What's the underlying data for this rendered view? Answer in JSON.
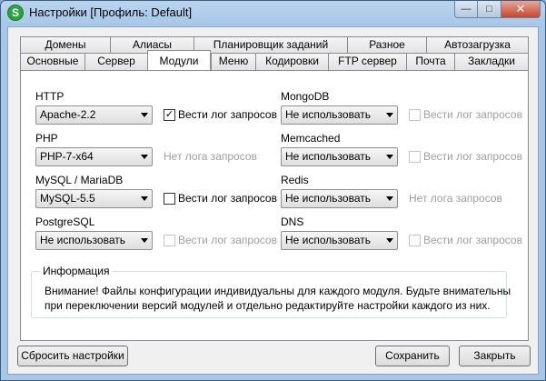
{
  "window": {
    "title": "Настройки [Профиль: Default]",
    "app_icon_letter": "S"
  },
  "tabs": {
    "row1": [
      "Домены",
      "Алиасы",
      "Планировщик заданий",
      "Разное",
      "Автозагрузка"
    ],
    "row2": [
      "Основные",
      "Сервер",
      "Модули",
      "Меню",
      "Кодировки",
      "FTP сервер",
      "Почта",
      "Закладки"
    ],
    "active": "Модули"
  },
  "modules": {
    "http": {
      "label": "HTTP",
      "value": "Apache-2.2",
      "log_label": "Вести лог запросов",
      "log_checked": true
    },
    "php": {
      "label": "PHP",
      "value": "PHP-7-x64",
      "no_log_text": "Нет лога запросов"
    },
    "mysql": {
      "label": "MySQL / MariaDB",
      "value": "MySQL-5.5",
      "log_label": "Вести лог запросов",
      "log_checked": false
    },
    "postgresql": {
      "label": "PostgreSQL",
      "value": "Не использовать",
      "log_label": "Вести лог запросов",
      "log_checked": false
    },
    "mongodb": {
      "label": "MongoDB",
      "value": "Не использовать",
      "log_label": "Вести лог запросов",
      "log_checked": false
    },
    "memcached": {
      "label": "Memcached",
      "value": "Не использовать",
      "log_label": "Вести лог запросов",
      "log_checked": false
    },
    "redis": {
      "label": "Redis",
      "value": "Не использовать",
      "no_log_text": "Нет лога запросов"
    },
    "dns": {
      "label": "DNS",
      "value": "Не использовать",
      "log_label": "Вести лог запросов",
      "log_checked": false
    }
  },
  "info": {
    "title": "Информация",
    "line1": "Внимание! Файлы конфигурации индивидуальны для каждого модуля. Будьте внимательны",
    "line2": "при переключении версий модулей и отдельно редактируйте настройки каждого из них."
  },
  "buttons": {
    "reset": "Сбросить настройки",
    "save": "Сохранить",
    "close": "Закрыть"
  }
}
